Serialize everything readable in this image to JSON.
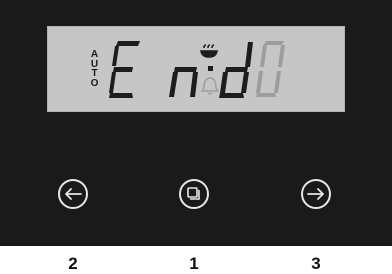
{
  "display": {
    "mode_label": "AUTO",
    "digits": [
      "E",
      "n",
      "d",
      "0"
    ],
    "active_digits": 3,
    "colors": {
      "lcd_background": "#c6c6c6",
      "segment_on": "#1d1d1d",
      "segment_off": "#9d9d9d",
      "panel": "#1a1a1a",
      "button_ring": "#e6e6e6"
    },
    "indicators": [
      "bowl-icon",
      "bell-icon"
    ]
  },
  "controls": {
    "left_icon": "arrow-left-icon",
    "center_icon": "layers-icon",
    "right_icon": "arrow-right-icon"
  },
  "labels": {
    "left": "2",
    "center": "1",
    "right": "3"
  }
}
